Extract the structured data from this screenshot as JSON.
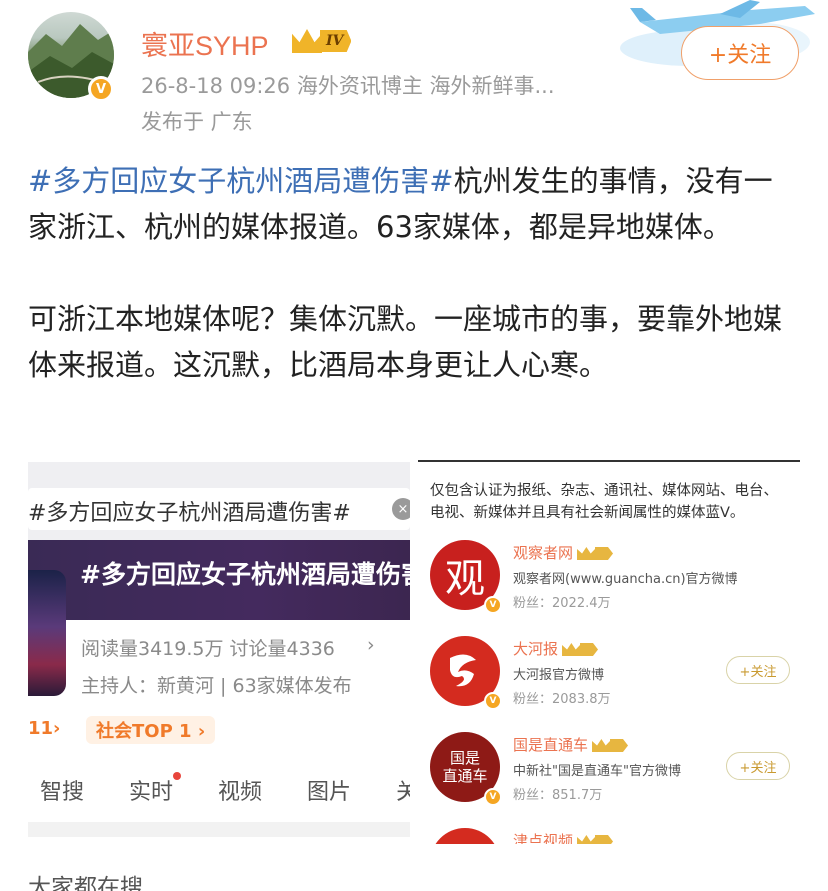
{
  "header": {
    "username": "寰亚SYHP",
    "level_badge": "IV",
    "meta": "26-8-18 09:26  海外资讯博主 海外新鲜事...",
    "location": "发布于 广东",
    "follow_label": "+关注"
  },
  "post": {
    "hashtag": "#多方回应女子杭州酒局遭伤害#",
    "line1_rest": "杭州发生的事情，没有一家浙江、杭州的媒体报道。63家媒体，都是异地媒体。",
    "paragraph2": "可浙江本地媒体呢？集体沉默。一座城市的事，要靠外地媒体来报道。这沉默，比酒局本身更让人心寒。"
  },
  "left_screenshot": {
    "search_text": "#多方回应女子杭州酒局遭伤害#",
    "clear_icon": "×",
    "banner_title": "#多方回应女子杭州酒局遭伤害#",
    "reads": "阅读量3419.5万  讨论量4336",
    "chevron": "›",
    "host": "主持人：新黄河 | 63家媒体发布",
    "rank_a": "11›",
    "rank_b": "社会TOP 1 ›",
    "tabs": [
      "智搜",
      "实时",
      "视频",
      "图片",
      "关"
    ]
  },
  "right_screenshot": {
    "intro": "仅包含认证为报纸、杂志、通讯社、媒体网站、电台、电视、新媒体并且具有社会新闻属性的媒体蓝V。",
    "media": [
      {
        "name": "观察者网",
        "logo_text": "观",
        "desc": "观察者网(www.guancha.cn)官方微博",
        "fans": "粉丝：2022.4万",
        "follow": "",
        "color": "#c8201e"
      },
      {
        "name": "大河报",
        "logo_text": "大",
        "desc": "大河报官方微博",
        "fans": "粉丝：2083.8万",
        "follow": "+关注",
        "color": "#d42b1f"
      },
      {
        "name": "国是直通车",
        "logo_text": "国是\n直通车",
        "desc": "中新社\"国是直通车\"官方微博",
        "fans": "粉丝：851.7万",
        "follow": "+关注",
        "color": "#8e1a16"
      },
      {
        "name": "津点视频",
        "logo_text": "",
        "desc": "",
        "fans": "",
        "follow": "",
        "color": "#d42b1f"
      }
    ]
  },
  "bottom_text": "大家都在搜",
  "colors": {
    "accent": "#eb7350",
    "hashtag": "#3e6fb5",
    "follow": "#f07a2a"
  }
}
